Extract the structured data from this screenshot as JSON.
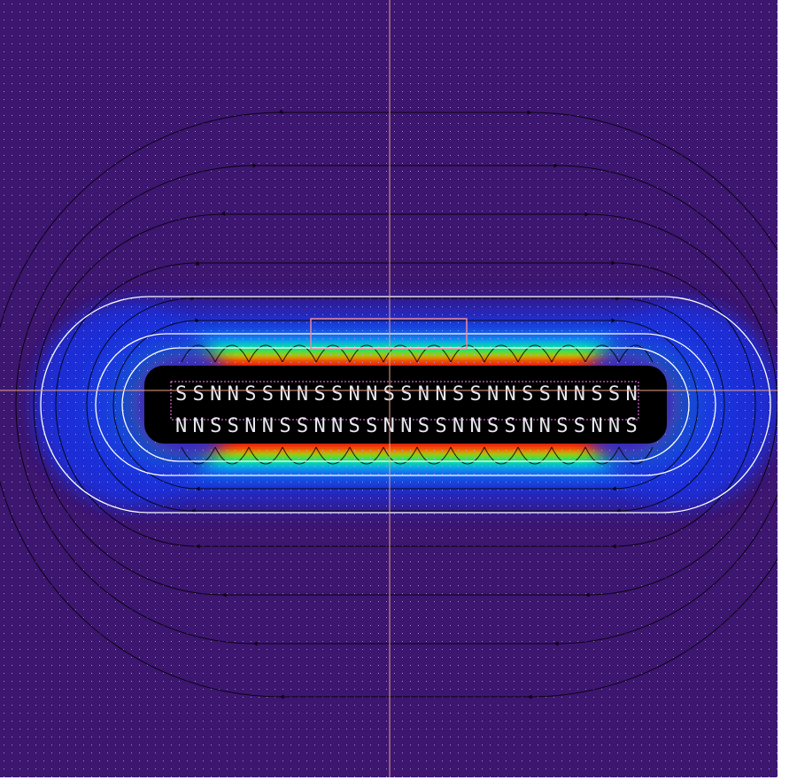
{
  "view": {
    "background_color": "#3d1670",
    "dot_grid_color": "#c8b8ff",
    "crosshair_color": "#e7a58c",
    "magnet_outline_color": "#ff80ff",
    "probe_box_color": "#e88aa0",
    "field_line_color": "#000000",
    "contour_color": "#ffffff"
  },
  "colormap": [
    "#3d1670",
    "#1a2fd8",
    "#0a8cff",
    "#00e0d0",
    "#20e020",
    "#f0f000",
    "#ff7000",
    "#e01010",
    "#000000"
  ],
  "magnet_array": {
    "top_row": [
      "S",
      "S",
      "N",
      "N",
      "S",
      "S",
      "N",
      "N",
      "S",
      "S",
      "N",
      "N",
      "S",
      "S",
      "N",
      "N",
      "S",
      "S",
      "N",
      "N",
      "S",
      "S",
      "N",
      "N",
      "S",
      "S",
      "N"
    ],
    "bottom_row": [
      "N",
      "N",
      "S",
      "S",
      "N",
      "N",
      "S",
      "S",
      "N",
      "N",
      "S",
      "S",
      "N",
      "N",
      "S",
      "S",
      "N",
      "N",
      "S",
      "S",
      "N",
      "N",
      "S",
      "S",
      "N",
      "N",
      "S"
    ]
  }
}
